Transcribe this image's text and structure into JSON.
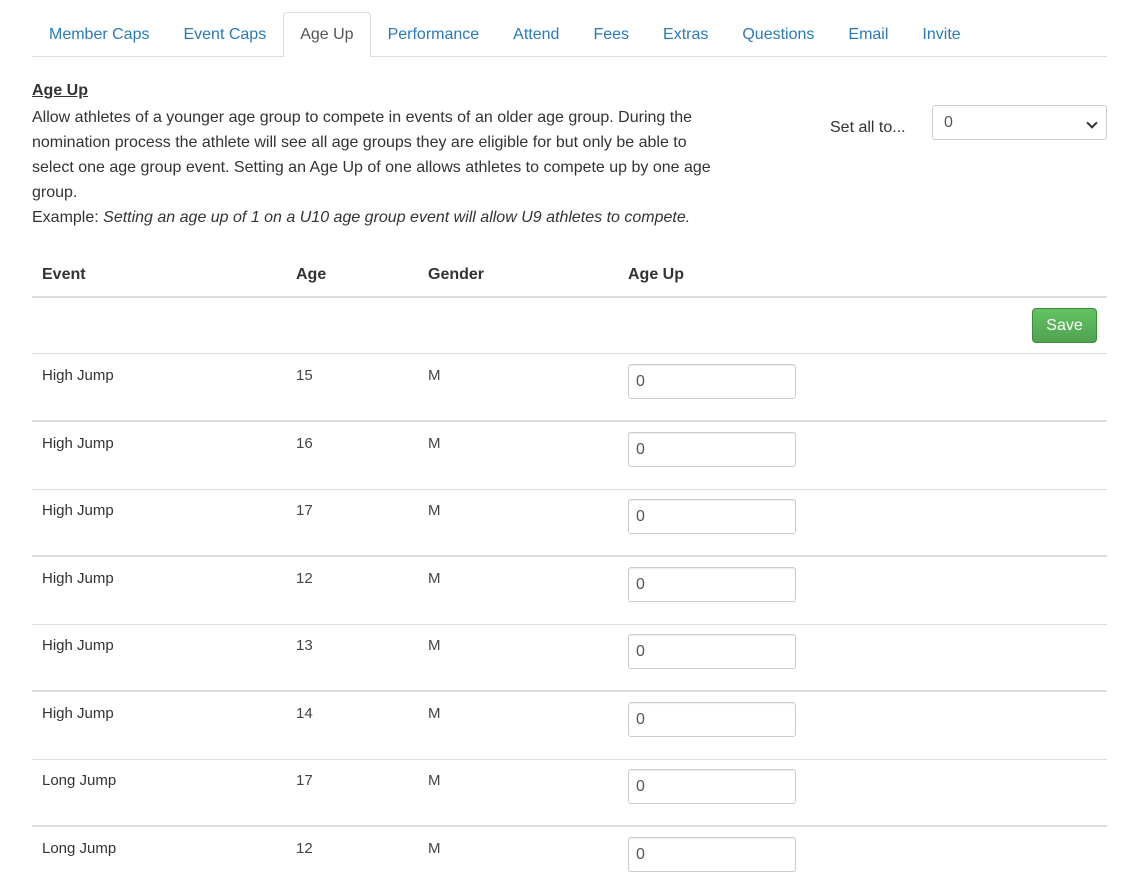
{
  "tabs": [
    {
      "label": "Member Caps"
    },
    {
      "label": "Event Caps"
    },
    {
      "label": "Age Up"
    },
    {
      "label": "Performance"
    },
    {
      "label": "Attend"
    },
    {
      "label": "Fees"
    },
    {
      "label": "Extras"
    },
    {
      "label": "Questions"
    },
    {
      "label": "Email"
    },
    {
      "label": "Invite"
    }
  ],
  "active_tab": "Age Up",
  "description": {
    "title": "Age Up",
    "text": "Allow athletes of a younger age group to compete in events of an older age group. During the nomination process the athlete will see all age groups they are eligible for but only be able to select one age group event. Setting an Age Up of one allows athletes to compete up by one age group.",
    "example_label": "Example: ",
    "example_text": "Setting an age up of 1 on a U10 age group event will allow U9 athletes to compete."
  },
  "set_all": {
    "label": "Set all to...",
    "selected": "0"
  },
  "table": {
    "headers": {
      "event": "Event",
      "age": "Age",
      "gender": "Gender",
      "age_up": "Age Up"
    },
    "save_label": "Save",
    "rows": [
      {
        "event": "High Jump",
        "age": "15",
        "gender": "M",
        "age_up": "0"
      },
      {
        "event": "High Jump",
        "age": "16",
        "gender": "M",
        "age_up": "0"
      },
      {
        "event": "High Jump",
        "age": "17",
        "gender": "M",
        "age_up": "0"
      },
      {
        "event": "High Jump",
        "age": "12",
        "gender": "M",
        "age_up": "0"
      },
      {
        "event": "High Jump",
        "age": "13",
        "gender": "M",
        "age_up": "0"
      },
      {
        "event": "High Jump",
        "age": "14",
        "gender": "M",
        "age_up": "0"
      },
      {
        "event": "Long Jump",
        "age": "17",
        "gender": "M",
        "age_up": "0"
      },
      {
        "event": "Long Jump",
        "age": "12",
        "gender": "M",
        "age_up": "0"
      }
    ]
  },
  "colors": {
    "link": "#2a7ab8",
    "save_button": "#5cb85c",
    "border": "#dddddd"
  }
}
